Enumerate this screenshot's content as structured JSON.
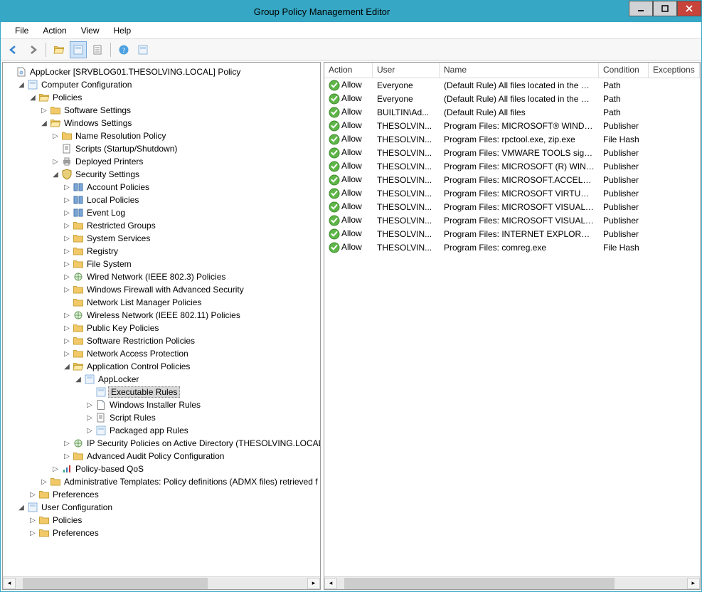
{
  "window": {
    "title": "Group Policy Management Editor"
  },
  "menu": {
    "items": [
      "File",
      "Action",
      "View",
      "Help"
    ]
  },
  "tree": {
    "root": "AppLocker [SRVBLOG01.THESOLVING.LOCAL] Policy",
    "comp_conf": "Computer Configuration",
    "policies": "Policies",
    "software_settings": "Software Settings",
    "windows_settings": "Windows Settings",
    "name_res": "Name Resolution Policy",
    "scripts": "Scripts (Startup/Shutdown)",
    "deployed_printers": "Deployed Printers",
    "security_settings": "Security Settings",
    "account_pol": "Account Policies",
    "local_pol": "Local Policies",
    "event_log": "Event Log",
    "restricted_groups": "Restricted Groups",
    "system_services": "System Services",
    "registry": "Registry",
    "file_system": "File System",
    "wired_net": "Wired Network (IEEE 802.3) Policies",
    "win_firewall": "Windows Firewall with Advanced Security",
    "net_list": "Network List Manager Policies",
    "wireless_net": "Wireless Network (IEEE 802.11) Policies",
    "pubkey": "Public Key Policies",
    "softrestrict": "Software Restriction Policies",
    "nap": "Network Access Protection",
    "app_ctrl": "Application Control Policies",
    "applocker": "AppLocker",
    "exe_rules": "Executable Rules",
    "msi_rules": "Windows Installer Rules",
    "script_rules": "Script Rules",
    "packaged_rules": "Packaged app Rules",
    "ipsec": "IP Security Policies on Active Directory (THESOLVING.LOCAL",
    "advaudit": "Advanced Audit Policy Configuration",
    "policyqos": "Policy-based QoS",
    "admx": "Administrative Templates: Policy definitions (ADMX files) retrieved f",
    "prefs": "Preferences",
    "user_conf": "User Configuration",
    "user_policies": "Policies",
    "user_prefs": "Preferences"
  },
  "columns": {
    "action": "Action",
    "user": "User",
    "name": "Name",
    "condition": "Condition",
    "exceptions": "Exceptions"
  },
  "rows": [
    {
      "action": "Allow",
      "user": "Everyone",
      "name": "(Default Rule) All files located in the Pro...",
      "condition": "Path"
    },
    {
      "action": "Allow",
      "user": "Everyone",
      "name": "(Default Rule) All files located in the Wi...",
      "condition": "Path"
    },
    {
      "action": "Allow",
      "user": "BUILTIN\\Ad...",
      "name": "(Default Rule) All files",
      "condition": "Path"
    },
    {
      "action": "Allow",
      "user": "THESOLVIN...",
      "name": "Program Files: MICROSOFT® WINDOW...",
      "condition": "Publisher"
    },
    {
      "action": "Allow",
      "user": "THESOLVIN...",
      "name": "Program Files: rpctool.exe, zip.exe",
      "condition": "File Hash"
    },
    {
      "action": "Allow",
      "user": "THESOLVIN...",
      "name": "Program Files: VMWARE TOOLS signed ...",
      "condition": "Publisher"
    },
    {
      "action": "Allow",
      "user": "THESOLVIN...",
      "name": "Program Files: MICROSOFT (R) WINDO...",
      "condition": "Publisher"
    },
    {
      "action": "Allow",
      "user": "THESOLVIN...",
      "name": "Program Files: MICROSOFT.ACCELERA...",
      "condition": "Publisher"
    },
    {
      "action": "Allow",
      "user": "THESOLVIN...",
      "name": "Program Files: MICROSOFT VIRTUAL M...",
      "condition": "Publisher"
    },
    {
      "action": "Allow",
      "user": "THESOLVIN...",
      "name": "Program Files: MICROSOFT VISUAL C+...",
      "condition": "Publisher"
    },
    {
      "action": "Allow",
      "user": "THESOLVIN...",
      "name": "Program Files: MICROSOFT VISUAL C+...",
      "condition": "Publisher"
    },
    {
      "action": "Allow",
      "user": "THESOLVIN...",
      "name": "Program Files: INTERNET EXPLORER sig...",
      "condition": "Publisher"
    },
    {
      "action": "Allow",
      "user": "THESOLVIN...",
      "name": "Program Files: comreg.exe",
      "condition": "File Hash"
    }
  ]
}
